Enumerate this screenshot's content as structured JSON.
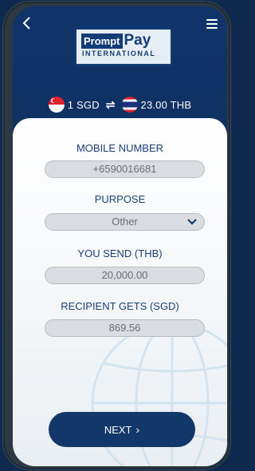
{
  "header": {
    "logo": {
      "prompt": "Prompt",
      "pay": "Pay",
      "sub": "INTERNATIONAL"
    }
  },
  "rate": {
    "from": "1 SGD",
    "to": "23.00 THB"
  },
  "form": {
    "mobile": {
      "label": "MOBILE NUMBER",
      "value": "+6590016681"
    },
    "purpose": {
      "label": "PURPOSE",
      "value": "Other"
    },
    "send": {
      "label": "YOU SEND (THB)",
      "value": "20,000.00"
    },
    "receive": {
      "label": "RECIPIENT GETS (SGD)",
      "value": "869.56"
    }
  },
  "actions": {
    "next": "NEXT"
  },
  "colors": {
    "background_blue": "#10346a",
    "label_blue": "#1c3f78",
    "button_blue": "#12386a"
  }
}
